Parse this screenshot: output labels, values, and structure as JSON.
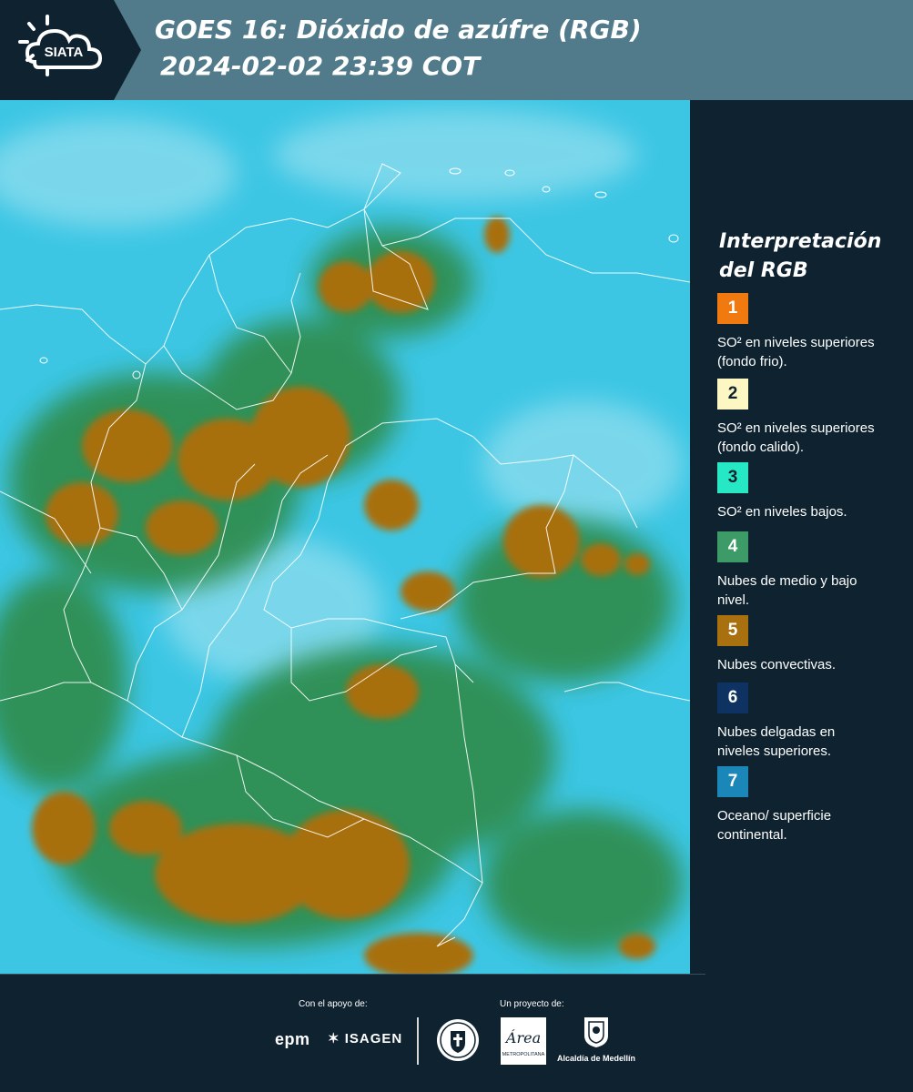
{
  "header": {
    "logo_text": "SIATA",
    "title_line1": "GOES 16: Dióxido de azúfre (RGB)",
    "title_line2": "2024-02-02 23:39 COT"
  },
  "legend": {
    "title_line1": "Interpretación",
    "title_line2": "del RGB",
    "items": [
      {
        "number": "1",
        "color": "#f07a10",
        "number_color": "#ffffff",
        "description": "SO² en niveles superiores (fondo frio)."
      },
      {
        "number": "2",
        "color": "#fdf7c3",
        "number_color": "#0f2230",
        "description": "SO² en niveles superiores (fondo calido)."
      },
      {
        "number": "3",
        "color": "#27e8c4",
        "number_color": "#0f2230",
        "description": "SO² en niveles bajos."
      },
      {
        "number": "4",
        "color": "#3c9b66",
        "number_color": "#ffffff",
        "description": "Nubes de medio y bajo nivel."
      },
      {
        "number": "5",
        "color": "#a8700f",
        "number_color": "#ffffff",
        "description": "Nubes convectivas."
      },
      {
        "number": "6",
        "color": "#0e3261",
        "number_color": "#ffffff",
        "description": "Nubes delgadas en niveles superiores."
      },
      {
        "number": "7",
        "color": "#1b86b8",
        "number_color": "#ffffff",
        "description": "Oceano/ superficie continental."
      }
    ]
  },
  "footer": {
    "support_label": "Con el apoyo de:",
    "project_label": "Un proyecto de:",
    "sponsor1": "epm",
    "sponsor2": "ISAGEN",
    "partner_area": "Área",
    "partner_area_sub": "METROPOLITANA",
    "partner_alcaldia": "Alcaldía de Medellín"
  },
  "map": {
    "ocean_color": "#3cc6e4",
    "cloud_convective_color": "#a8700f",
    "cloud_low_color": "#2e8b4a",
    "border_color": "#ffffff"
  }
}
